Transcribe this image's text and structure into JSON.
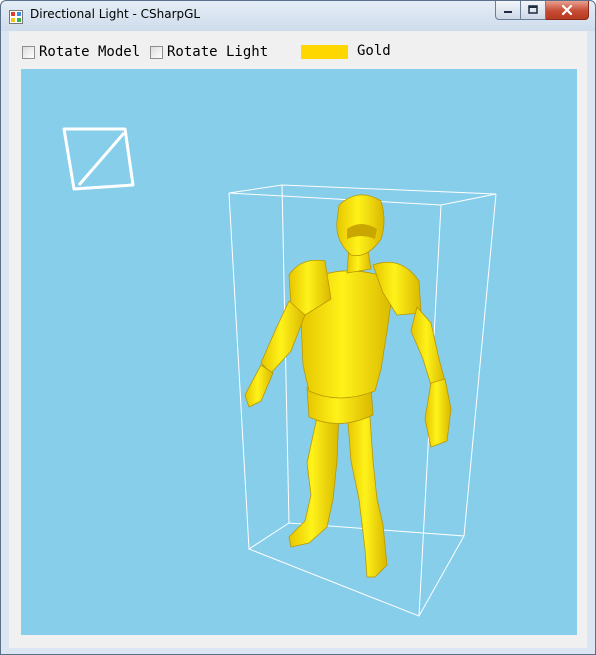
{
  "window": {
    "title": "Directional Light - CSharpGL"
  },
  "toolbar": {
    "rotate_model_label": "Rotate Model",
    "rotate_light_label": "Rotate Light",
    "rotate_model_checked": false,
    "rotate_light_checked": false,
    "material_color": "#ffd700",
    "material_label": "Gold"
  },
  "viewport": {
    "background_color": "#87ceeb",
    "model_color": "#ffee00",
    "wireframe_color": "#ffffff",
    "light_indicator": "directional-light-icon",
    "model": "character-model"
  }
}
